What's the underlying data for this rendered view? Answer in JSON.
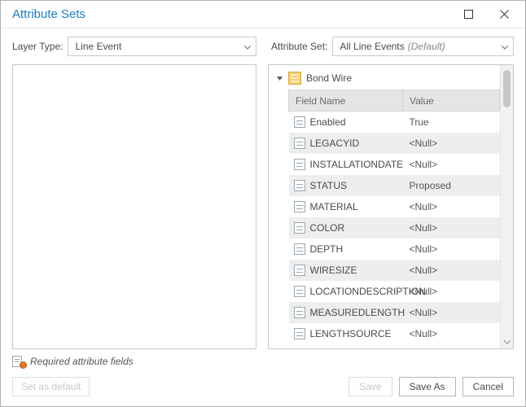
{
  "title": "Attribute Sets",
  "layerType": {
    "label": "Layer Type:",
    "value": "Line Event"
  },
  "attributeSet": {
    "label": "Attribute Set:",
    "value": "All Line Events",
    "suffix": "(Default)"
  },
  "tree": {
    "root": "Bond Wire",
    "columns": {
      "field": "Field Name",
      "value": "Value"
    },
    "rows": [
      {
        "name": "Enabled",
        "value": "True"
      },
      {
        "name": "LEGACYID",
        "value": "<Null>"
      },
      {
        "name": "INSTALLATIONDATE",
        "value": "<Null>"
      },
      {
        "name": "STATUS",
        "value": "Proposed"
      },
      {
        "name": "MATERIAL",
        "value": "<Null>"
      },
      {
        "name": "COLOR",
        "value": "<Null>"
      },
      {
        "name": "DEPTH",
        "value": "<Null>"
      },
      {
        "name": "WIRESIZE",
        "value": "<Null>"
      },
      {
        "name": "LOCATIONDESCRIPTION",
        "value": "<Null>"
      },
      {
        "name": "MEASUREDLENGTH",
        "value": "<Null>"
      },
      {
        "name": "LENGTHSOURCE",
        "value": "<Null>"
      }
    ]
  },
  "footerNote": "Required attribute fields",
  "buttons": {
    "setDefault": "Set as default",
    "save": "Save",
    "saveAs": "Save As",
    "cancel": "Cancel"
  }
}
